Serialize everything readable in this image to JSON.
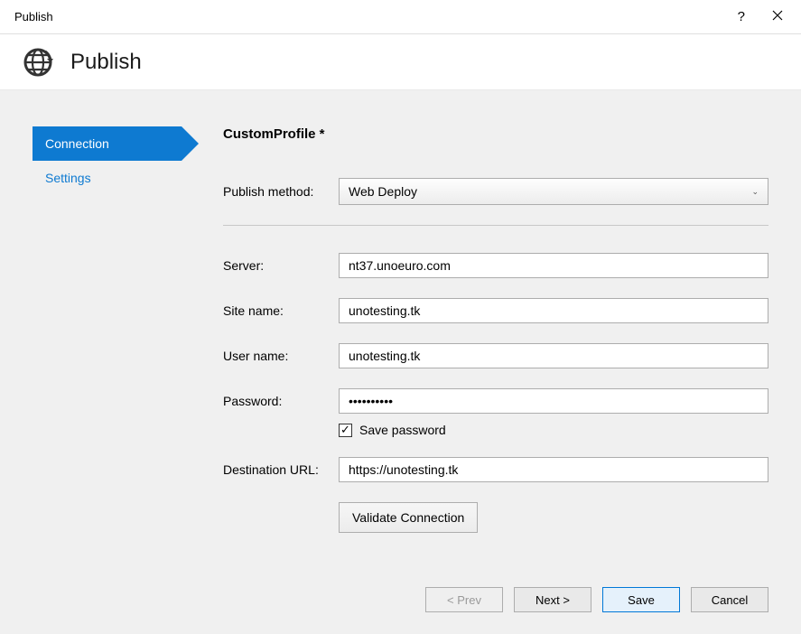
{
  "titlebar": {
    "title": "Publish"
  },
  "header": {
    "title": "Publish"
  },
  "sidebar": {
    "items": [
      {
        "label": "Connection",
        "active": true
      },
      {
        "label": "Settings",
        "active": false
      }
    ]
  },
  "main": {
    "profile_title": "CustomProfile *",
    "publish_method_label": "Publish method:",
    "publish_method_value": "Web Deploy",
    "server_label": "Server:",
    "server_value": "nt37.unoeuro.com",
    "sitename_label": "Site name:",
    "sitename_value": "unotesting.tk",
    "username_label": "User name:",
    "username_value": "unotesting.tk",
    "password_label": "Password:",
    "password_value": "••••••••••",
    "save_password_checked": true,
    "save_password_label": "Save password",
    "desturl_label": "Destination URL:",
    "desturl_value": "https://unotesting.tk",
    "validate_label": "Validate Connection"
  },
  "footer": {
    "prev": "< Prev",
    "next": "Next >",
    "save": "Save",
    "cancel": "Cancel"
  }
}
